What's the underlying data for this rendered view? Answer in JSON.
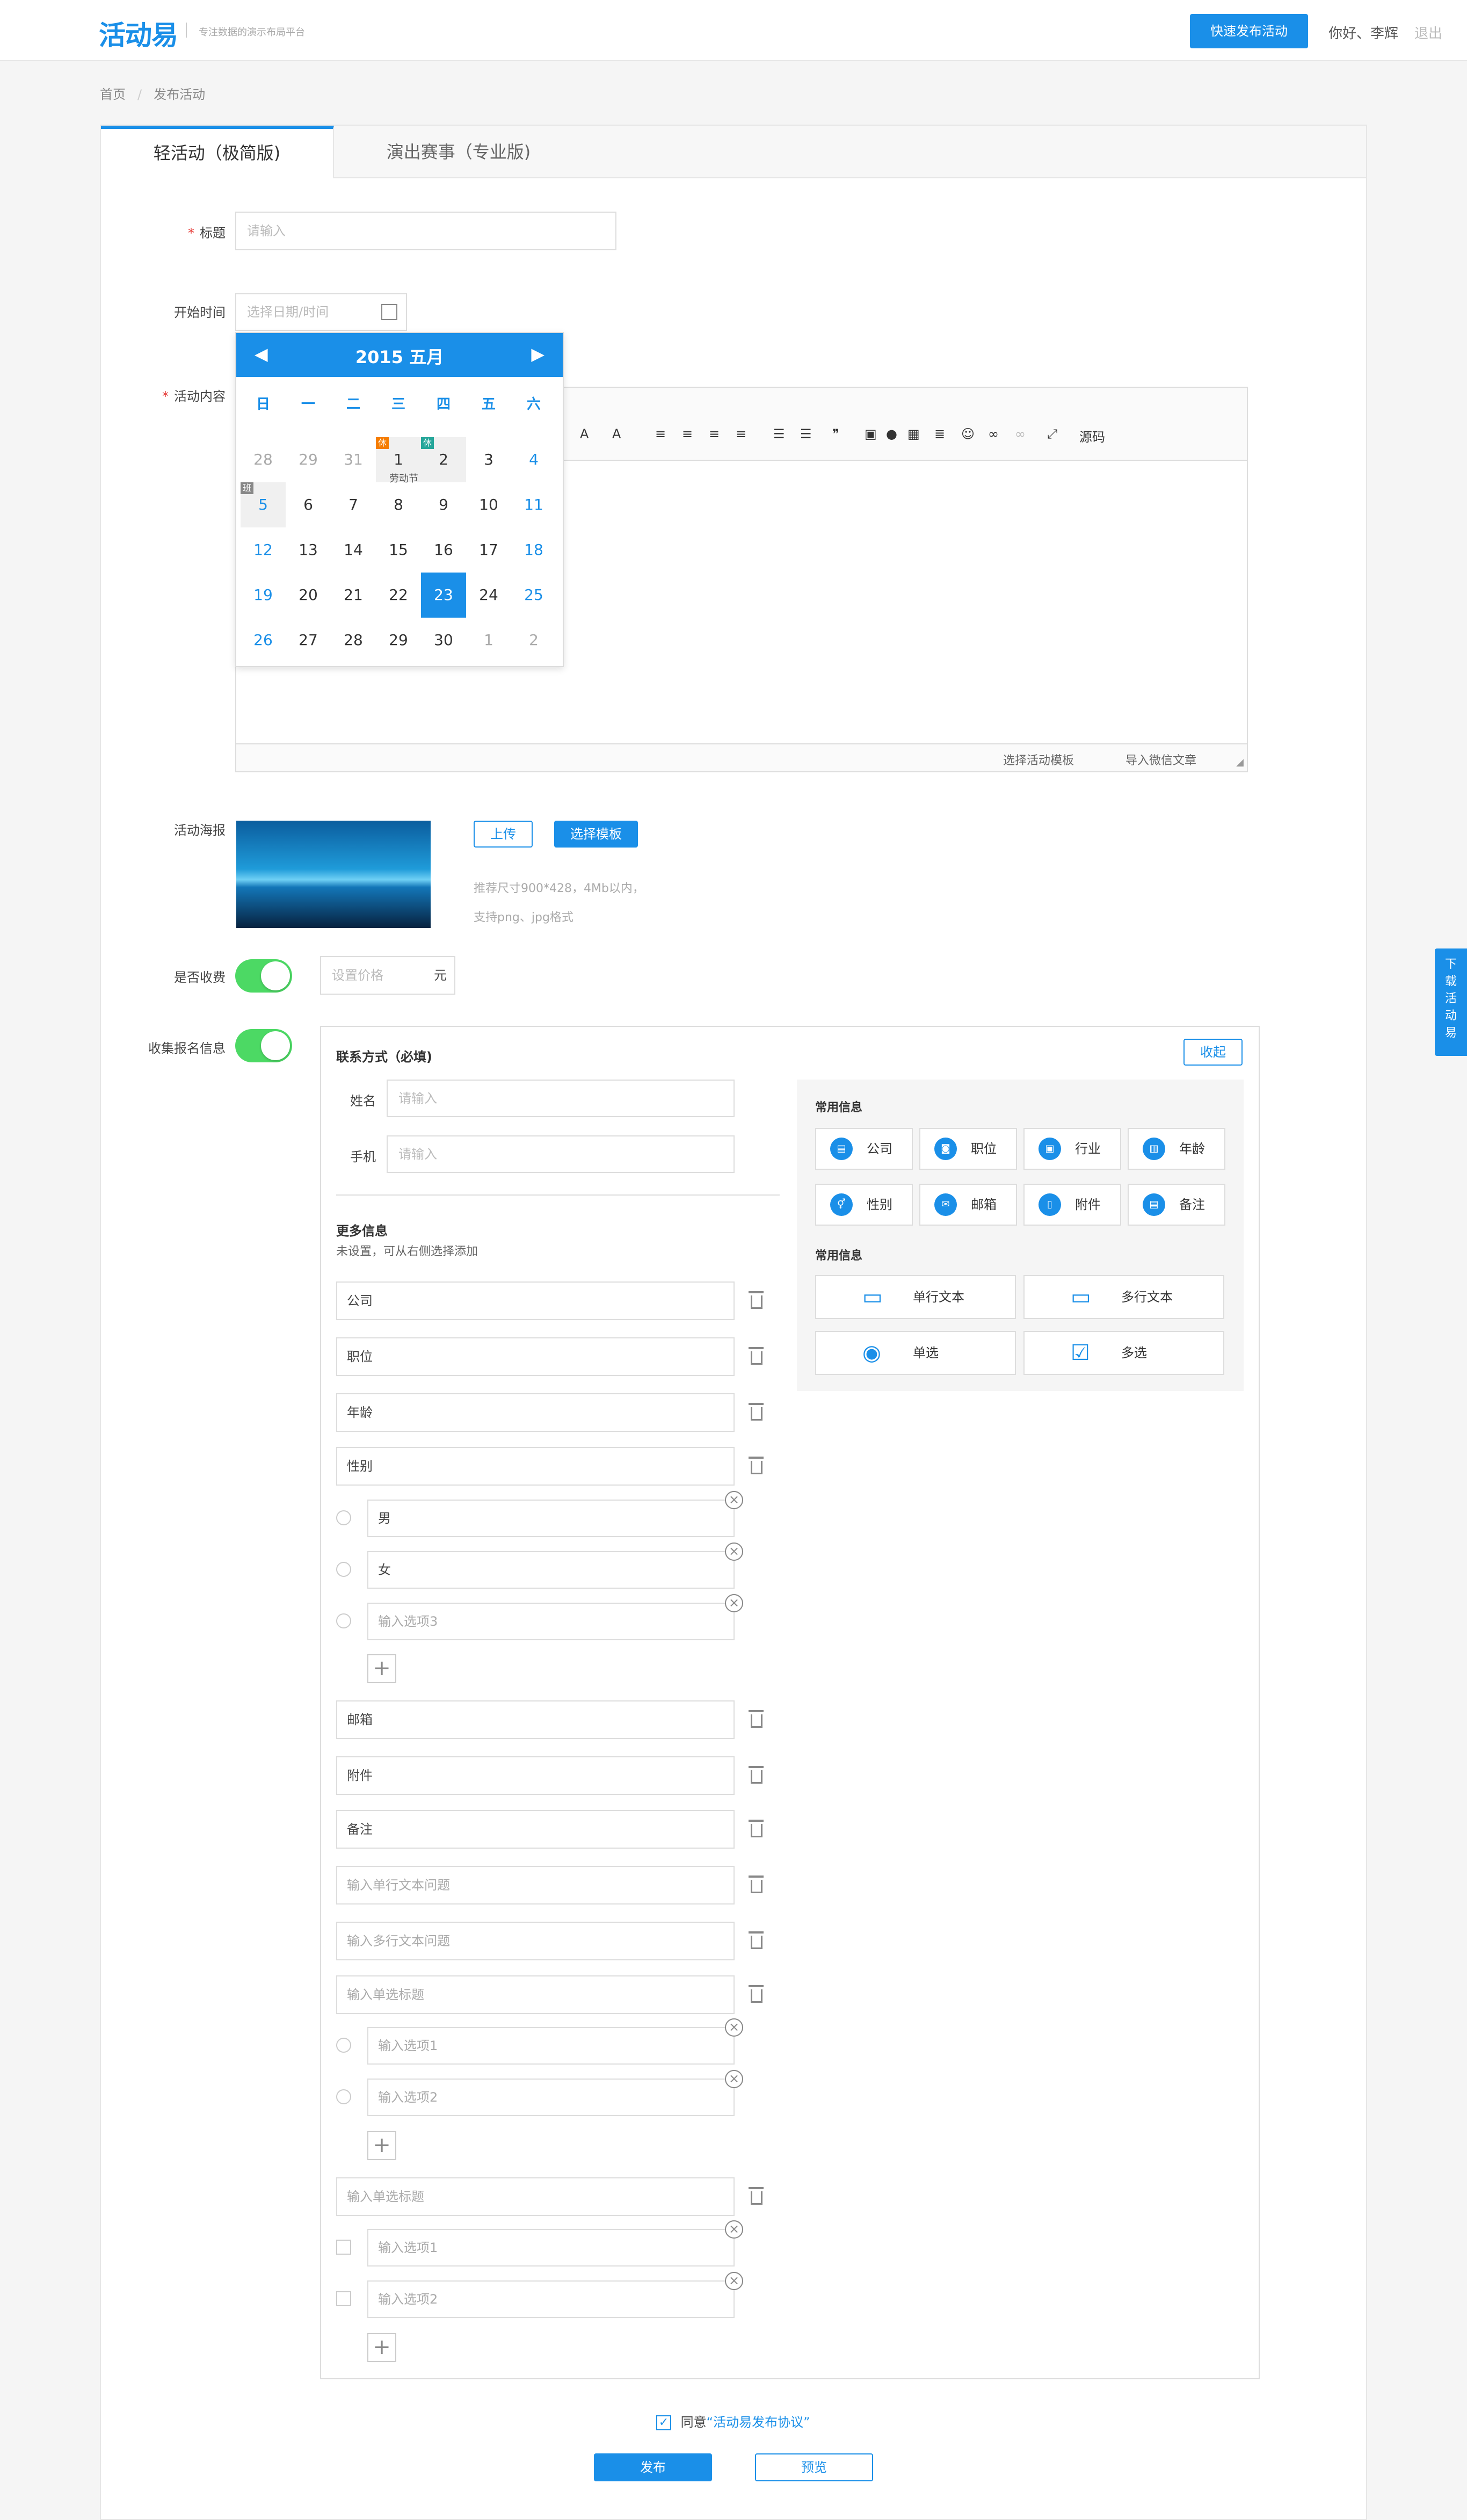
{
  "header": {
    "logo": "活动易",
    "tagline": "专注数据的演示布局平台",
    "publish_btn": "快速发布活动",
    "greeting": "你好、李辉",
    "logout": "退出"
  },
  "breadcrumb": {
    "home": "首页",
    "current": "发布活动"
  },
  "tabs": [
    {
      "label": "轻活动（极简版)"
    },
    {
      "label": "演出赛事（专业版)"
    }
  ],
  "form": {
    "title_label": "标题",
    "title_placeholder": "请输入",
    "start_label": "开始时间",
    "start_placeholder": "选择日期/时间",
    "content_label": "活动内容",
    "poster_label": "活动海报",
    "upload_btn": "上传",
    "template_btn": "选择模板",
    "poster_hint1": "推荐尺寸900*428，4Mb以内，",
    "poster_hint2": "支持png、jpg格式",
    "fee_label": "是否收费",
    "price_placeholder": "设置价格",
    "price_unit": "元",
    "collect_label": "收集报名信息"
  },
  "calendar": {
    "title": "2015 五月",
    "weekdays": [
      "日",
      "一",
      "二",
      "三",
      "四",
      "五",
      "六"
    ],
    "rows": [
      [
        "28",
        "29",
        "31",
        "1",
        "2",
        "3",
        "4"
      ],
      [
        "5",
        "6",
        "7",
        "8",
        "9",
        "10",
        "11"
      ],
      [
        "12",
        "13",
        "14",
        "15",
        "16",
        "17",
        "18"
      ],
      [
        "19",
        "20",
        "21",
        "22",
        "23",
        "24",
        "25"
      ],
      [
        "26",
        "27",
        "28",
        "29",
        "30",
        "1",
        "2"
      ]
    ],
    "holiday_label": "劳动节",
    "badge_rest": "休",
    "badge_work": "班",
    "selected": "23"
  },
  "editor": {
    "toolbar": [
      "A",
      "A",
      "¶",
      "源码"
    ],
    "footer_links": [
      "选择活动模板",
      "导入微信文章"
    ]
  },
  "registration": {
    "contact_title": "联系方式（必填)",
    "collapse_btn": "收起",
    "name_label": "姓名",
    "name_placeholder": "请输入",
    "phone_label": "手机",
    "phone_placeholder": "请输入",
    "more_title": "更多信息",
    "more_hint": "未设置，可从右侧选择添加",
    "fields": [
      "公司",
      "职位",
      "年龄",
      "性别"
    ],
    "gender_options": [
      "男",
      "女"
    ],
    "option3_placeholder": "输入选项3",
    "fields2": [
      "邮箱",
      "附件",
      "备注"
    ],
    "single_text_ph": "输入单行文本问题",
    "multi_text_ph": "输入多行文本问题",
    "single_choice_ph": "输入单选标题",
    "opt1_ph": "输入选项1",
    "opt2_ph": "输入选项2",
    "multi_choice_ph": "输入单选标题"
  },
  "side_panel": {
    "common_title": "常用信息",
    "chips": [
      "公司",
      "职位",
      "行业",
      "年龄",
      "性别",
      "邮箱",
      "附件",
      "备注"
    ],
    "common_title2": "常用信息",
    "wide_chips": [
      "单行文本",
      "多行文本",
      "单选",
      "多选"
    ]
  },
  "footer": {
    "agree_prefix": "同意",
    "agree_link": "“活动易发布协议”",
    "publish_btn": "发布",
    "preview_btn": "预览"
  },
  "floating": {
    "label": "下载活动易"
  }
}
